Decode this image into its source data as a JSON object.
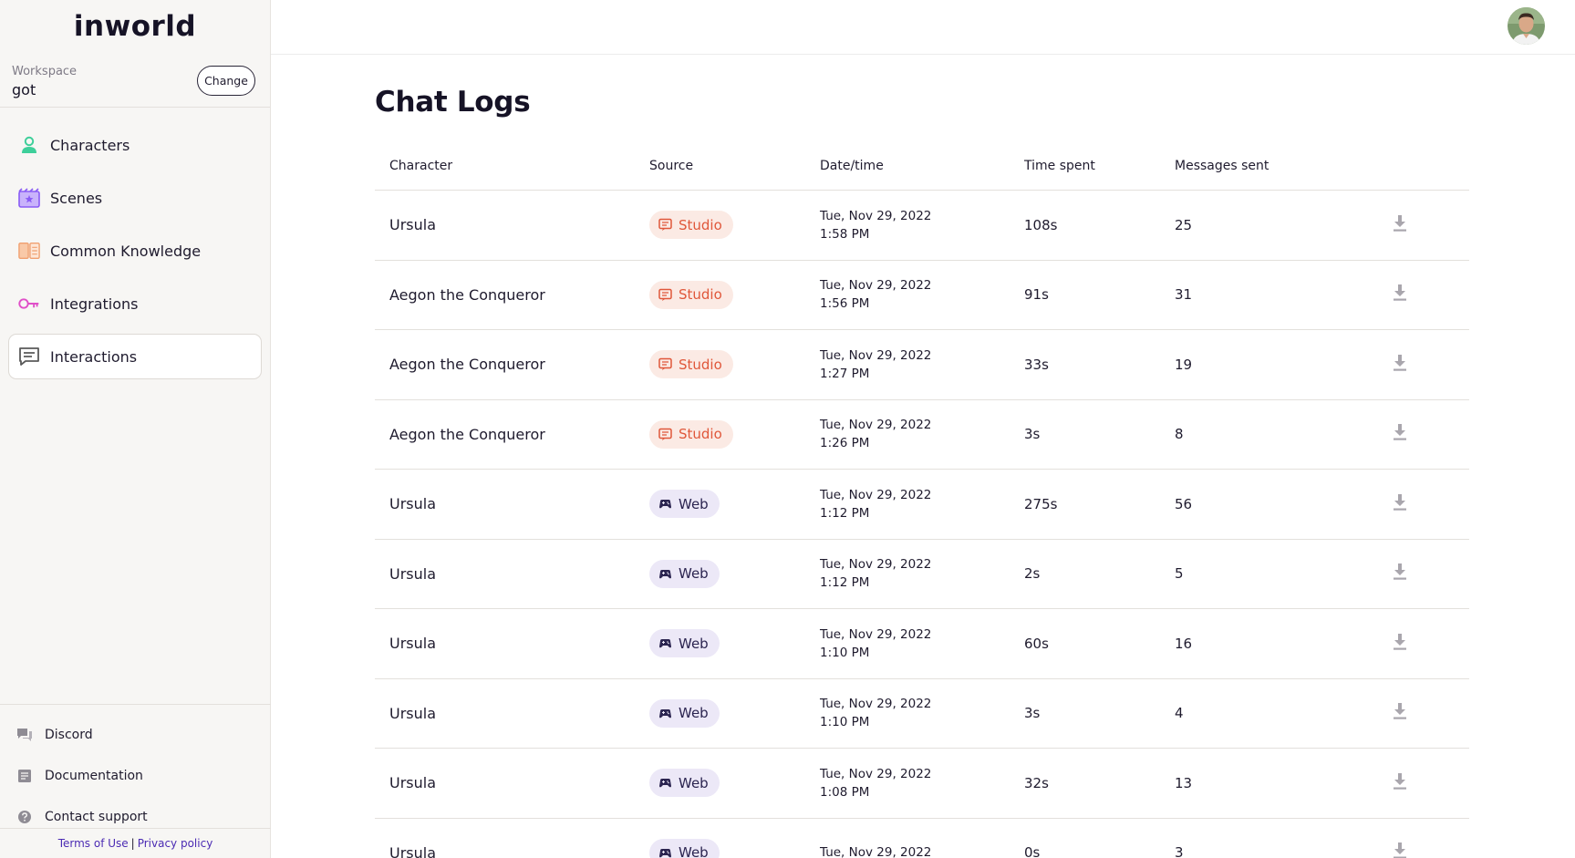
{
  "app": {
    "logo": "inworld"
  },
  "workspace": {
    "label": "Workspace",
    "name": "got",
    "change_label": "Change"
  },
  "sidebar": {
    "items": [
      {
        "label": "Characters",
        "icon": "person-icon",
        "color": "#3ecf9a"
      },
      {
        "label": "Scenes",
        "icon": "scene-icon",
        "color": "#8a5cf5"
      },
      {
        "label": "Common Knowledge",
        "icon": "book-icon",
        "color": "#f0a070"
      },
      {
        "label": "Integrations",
        "icon": "key-icon",
        "color": "#e04fc8"
      },
      {
        "label": "Interactions",
        "icon": "chat-icon",
        "color": "#6a6a6a"
      }
    ],
    "active_index": 4
  },
  "footer": {
    "links": [
      {
        "label": "Discord",
        "icon": "discord-icon"
      },
      {
        "label": "Documentation",
        "icon": "document-icon"
      },
      {
        "label": "Contact support",
        "icon": "help-icon"
      }
    ],
    "terms": "Terms of Use",
    "separator": "|",
    "privacy": "Privacy policy"
  },
  "page": {
    "title": "Chat Logs"
  },
  "table": {
    "headers": {
      "character": "Character",
      "source": "Source",
      "datetime": "Date/time",
      "time_spent": "Time spent",
      "messages": "Messages sent"
    },
    "rows": [
      {
        "character": "Ursula",
        "source": "Studio",
        "date": "Tue, Nov 29, 2022",
        "time": "1:58 PM",
        "spent": "108s",
        "messages": "25"
      },
      {
        "character": "Aegon the Conqueror",
        "source": "Studio",
        "date": "Tue, Nov 29, 2022",
        "time": "1:56 PM",
        "spent": "91s",
        "messages": "31"
      },
      {
        "character": "Aegon the Conqueror",
        "source": "Studio",
        "date": "Tue, Nov 29, 2022",
        "time": "1:27 PM",
        "spent": "33s",
        "messages": "19"
      },
      {
        "character": "Aegon the Conqueror",
        "source": "Studio",
        "date": "Tue, Nov 29, 2022",
        "time": "1:26 PM",
        "spent": "3s",
        "messages": "8"
      },
      {
        "character": "Ursula",
        "source": "Web",
        "date": "Tue, Nov 29, 2022",
        "time": "1:12 PM",
        "spent": "275s",
        "messages": "56"
      },
      {
        "character": "Ursula",
        "source": "Web",
        "date": "Tue, Nov 29, 2022",
        "time": "1:12 PM",
        "spent": "2s",
        "messages": "5"
      },
      {
        "character": "Ursula",
        "source": "Web",
        "date": "Tue, Nov 29, 2022",
        "time": "1:10 PM",
        "spent": "60s",
        "messages": "16"
      },
      {
        "character": "Ursula",
        "source": "Web",
        "date": "Tue, Nov 29, 2022",
        "time": "1:10 PM",
        "spent": "3s",
        "messages": "4"
      },
      {
        "character": "Ursula",
        "source": "Web",
        "date": "Tue, Nov 29, 2022",
        "time": "1:08 PM",
        "spent": "32s",
        "messages": "13"
      },
      {
        "character": "Ursula",
        "source": "Web",
        "date": "Tue, Nov 29, 2022",
        "time": "",
        "spent": "0s",
        "messages": "3"
      }
    ]
  },
  "colors": {
    "studio_bg": "#fbeae4",
    "studio_fg": "#e0573a",
    "web_bg": "#ece8f7",
    "web_fg": "#2b2450"
  }
}
